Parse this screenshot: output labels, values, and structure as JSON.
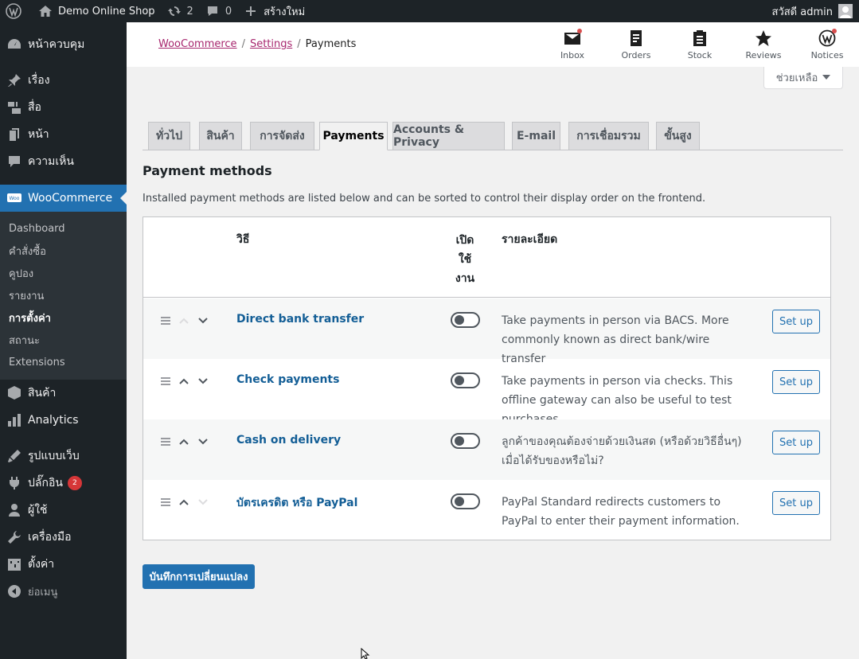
{
  "admin_bar": {
    "site_name": "Demo Online Shop",
    "updates_count": "2",
    "comments_count": "0",
    "new_label": "สร้างใหม่",
    "greeting": "สวัสดี admin"
  },
  "sidebar": {
    "items_top": [
      {
        "label": "หน้าควบคุม",
        "icon": "dashboard-icon"
      },
      {
        "label": "เรื่อง",
        "icon": "pin-icon"
      },
      {
        "label": "สื่อ",
        "icon": "media-icon"
      },
      {
        "label": "หน้า",
        "icon": "page-icon"
      },
      {
        "label": "ความเห็น",
        "icon": "comment-icon"
      }
    ],
    "woocommerce": {
      "label": "WooCommerce",
      "icon": "woo-icon"
    },
    "submenu": [
      {
        "label": "Dashboard"
      },
      {
        "label": "คำสั่งซื้อ"
      },
      {
        "label": "คูปอง"
      },
      {
        "label": "รายงาน"
      },
      {
        "label": "การตั้งค่า",
        "current": true
      },
      {
        "label": "สถานะ"
      },
      {
        "label": "Extensions"
      }
    ],
    "items_bottom": [
      {
        "label": "สินค้า",
        "icon": "product-icon"
      },
      {
        "label": "Analytics",
        "icon": "analytics-icon"
      },
      {
        "label": "รูปแบบเว็บ",
        "icon": "appearance-icon"
      },
      {
        "label": "ปลั๊กอิน",
        "icon": "plugin-icon",
        "badge": "2"
      },
      {
        "label": "ผู้ใช้",
        "icon": "user-icon"
      },
      {
        "label": "เครื่องมือ",
        "icon": "tools-icon"
      },
      {
        "label": "ตั้งค่า",
        "icon": "settings-icon"
      }
    ],
    "collapse_label": "ย่อเมนู"
  },
  "header": {
    "breadcrumb": [
      "WooCommerce",
      "Settings",
      "Payments"
    ],
    "activity": [
      {
        "label": "Inbox",
        "icon": "inbox-icon",
        "dot": true
      },
      {
        "label": "Orders",
        "icon": "orders-icon",
        "dot": false
      },
      {
        "label": "Stock",
        "icon": "stock-icon",
        "dot": false
      },
      {
        "label": "Reviews",
        "icon": "star-icon",
        "dot": false
      },
      {
        "label": "Notices",
        "icon": "wordpress-icon",
        "dot": true
      }
    ],
    "help_label": "ช่วยเหลือ"
  },
  "tabs": [
    {
      "label": "ทั่วไป"
    },
    {
      "label": "สินค้า"
    },
    {
      "label": "การจัดส่ง"
    },
    {
      "label": "Payments",
      "active": true
    },
    {
      "label": "Accounts & Privacy"
    },
    {
      "label": "E-mail"
    },
    {
      "label": "การเชื่อมรวม"
    },
    {
      "label": "ขั้นสูง"
    }
  ],
  "main": {
    "title": "Payment methods",
    "description": "Installed payment methods are listed below and can be sorted to control their display order on the frontend.",
    "table": {
      "headers": {
        "method": "วิธี",
        "enabled_1": "เปิด",
        "enabled_2": "ใช้",
        "enabled_3": "งาน",
        "description": "รายละเอียด"
      },
      "rows": [
        {
          "name": "Direct bank transfer",
          "enabled": false,
          "description": "Take payments in person via BACS. More commonly known as direct bank/wire transfer",
          "action": "Set up"
        },
        {
          "name": "Check payments",
          "enabled": false,
          "description": "Take payments in person via checks. This offline gateway can also be useful to test purchases.",
          "action": "Set up"
        },
        {
          "name": "Cash on delivery",
          "enabled": false,
          "description": "ลูกค้าของคุณต้องจ่ายด้วยเงินสด (หรือด้วยวิธีอื่นๆ) เมื่อได้รับของหรือไม่?",
          "action": "Set up"
        },
        {
          "name": "บัตรเครดิต หรือ PayPal",
          "enabled": false,
          "description": "PayPal Standard redirects customers to PayPal to enter their payment information.",
          "action": "Set up"
        }
      ]
    },
    "save_label": "บันทึกการเปลี่ยนแปลง"
  }
}
